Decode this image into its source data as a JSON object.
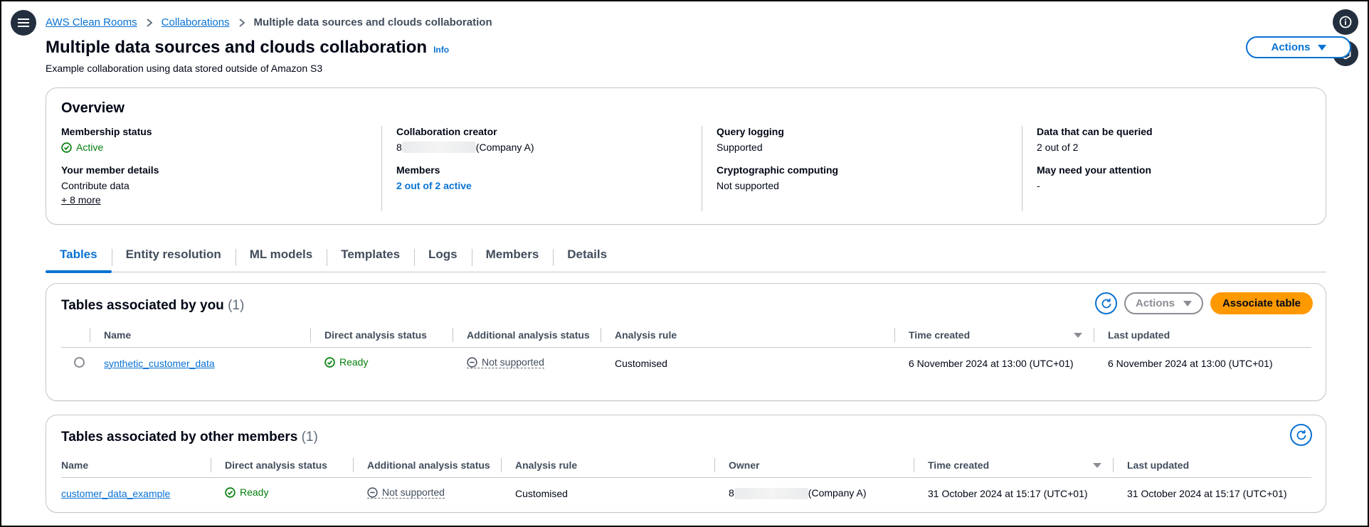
{
  "breadcrumb": {
    "items": [
      "AWS Clean Rooms",
      "Collaborations"
    ],
    "current": "Multiple data sources and clouds collaboration"
  },
  "page": {
    "title": "Multiple data sources and clouds collaboration",
    "info": "Info",
    "description": "Example collaboration using data stored outside of Amazon S3",
    "actions_label": "Actions"
  },
  "overview": {
    "title": "Overview",
    "membership_status_label": "Membership status",
    "membership_status_value": "Active",
    "member_details_label": "Your member details",
    "member_details_value": "Contribute data",
    "more_label": "+ 8 more",
    "creator_label": "Collaboration creator",
    "creator_prefix": "8",
    "creator_suffix": "(Company A)",
    "members_label": "Members",
    "members_value": "2 out of 2 active",
    "query_logging_label": "Query logging",
    "query_logging_value": "Supported",
    "crypto_label": "Cryptographic computing",
    "crypto_value": "Not supported",
    "queryable_label": "Data that can be queried",
    "queryable_value": "2 out of 2",
    "attention_label": "May need your attention",
    "attention_value": "-"
  },
  "tabs": [
    "Tables",
    "Entity resolution",
    "ML models",
    "Templates",
    "Logs",
    "Members",
    "Details"
  ],
  "tables_by_you": {
    "title": "Tables associated by you",
    "count": "(1)",
    "actions_label": "Actions",
    "associate_label": "Associate table",
    "columns": [
      "Name",
      "Direct analysis status",
      "Additional analysis status",
      "Analysis rule",
      "Time created",
      "Last updated"
    ],
    "rows": [
      {
        "name": "synthetic_customer_data",
        "direct_status": "Ready",
        "additional_status": "Not supported",
        "analysis_rule": "Customised",
        "time_created": "6 November 2024 at 13:00 (UTC+01)",
        "last_updated": "6 November 2024 at 13:00 (UTC+01)"
      }
    ]
  },
  "tables_by_others": {
    "title": "Tables associated by other members",
    "count": "(1)",
    "columns": [
      "Name",
      "Direct analysis status",
      "Additional analysis status",
      "Analysis rule",
      "Owner",
      "Time created",
      "Last updated"
    ],
    "rows": [
      {
        "name": "customer_data_example",
        "direct_status": "Ready",
        "additional_status": "Not supported",
        "analysis_rule": "Customised",
        "owner_prefix": "8",
        "owner_suffix": "(Company A)",
        "time_created": "31 October 2024 at 15:17 (UTC+01)",
        "last_updated": "31 October 2024 at 15:17 (UTC+01)"
      }
    ]
  },
  "colors": {
    "link": "#0972d3",
    "success": "#037f0c",
    "primary_button": "#ff9900",
    "dark_nav": "#232f3e"
  }
}
